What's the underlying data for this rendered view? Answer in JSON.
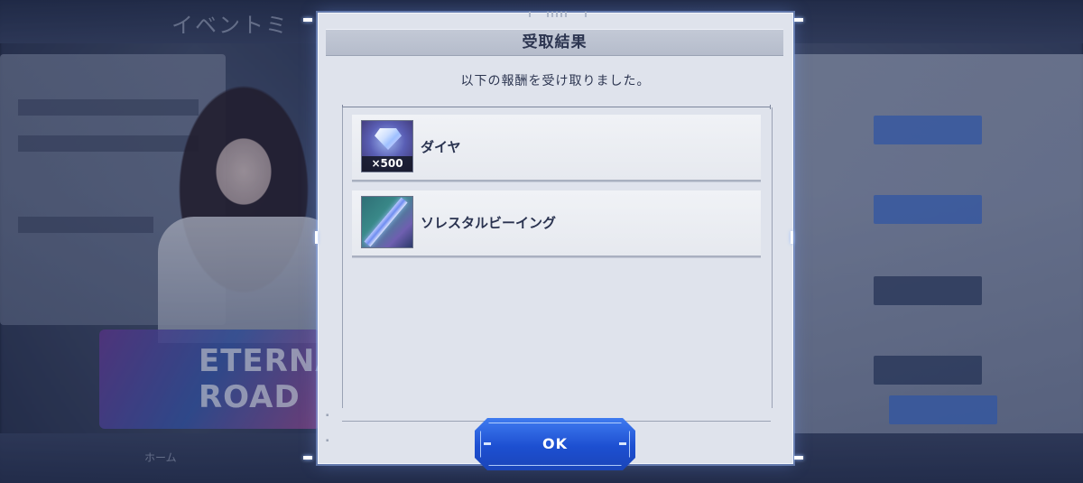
{
  "background": {
    "screen_title": "イベントミ",
    "banner_text": "ETERNAL\nROAD",
    "nav_home": "ホーム"
  },
  "dialog": {
    "title": "受取結果",
    "message": "以下の報酬を受け取りました。",
    "items": [
      {
        "name": "ダイヤ",
        "quantity": "×500",
        "icon": "diamond-icon"
      },
      {
        "name": "ソレスタルビーイング",
        "quantity": "",
        "icon": "celestial-being-item-icon"
      }
    ],
    "ok_label": "OK"
  },
  "colors": {
    "dialog_bg": "#dfe3ec",
    "accent_blue": "#1d4fd1",
    "text_dark": "#2c3550"
  }
}
